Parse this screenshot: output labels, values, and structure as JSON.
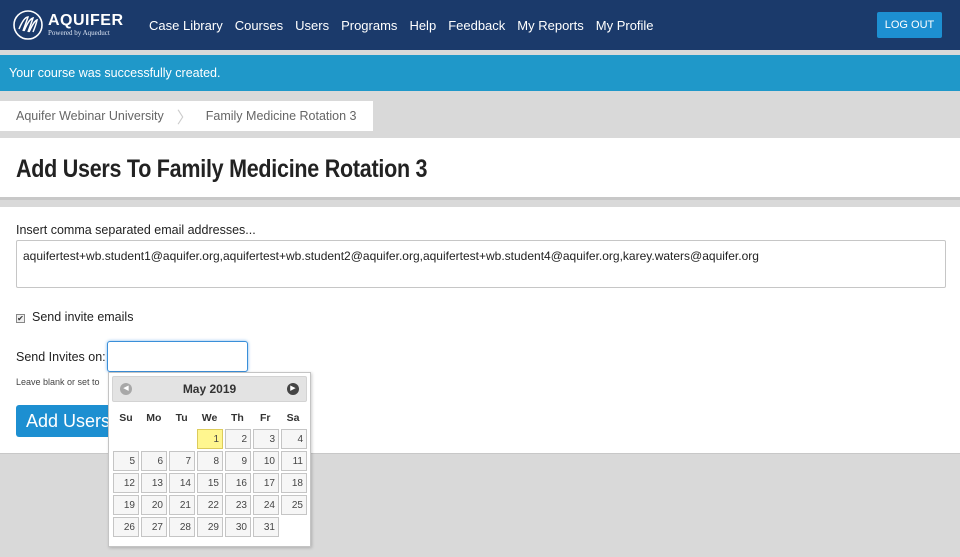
{
  "nav": {
    "logo_name": "AQUIFER",
    "logo_tagline": "Powered by Aqueduct",
    "links": [
      "Case Library",
      "Courses",
      "Users",
      "Programs",
      "Help",
      "Feedback",
      "My Reports",
      "My Profile"
    ],
    "logout_label": "LOG OUT"
  },
  "alert": {
    "message": "Your course was successfully created."
  },
  "breadcrumb": [
    "Aquifer Webinar University",
    "Family Medicine Rotation 3"
  ],
  "page": {
    "title": "Add Users To Family Medicine Rotation 3"
  },
  "form": {
    "emails_label": "Insert comma separated email addresses...",
    "emails_value": "aquifertest+wb.student1@aquifer.org,aquifertest+wb.student2@aquifer.org,aquifertest+wb.student4@aquifer.org,karey.waters@aquifer.org",
    "send_invites_label": "Send invite emails",
    "send_invites_checked": true,
    "send_on_label": "Send Invites on:",
    "send_on_value": "",
    "hint": "Leave blank or set to",
    "submit_label": "Add Users"
  },
  "datepicker": {
    "month_label": "May 2019",
    "weekdays": [
      "Su",
      "Mo",
      "Tu",
      "We",
      "Th",
      "Fr",
      "Sa"
    ],
    "first_weekday_index": 3,
    "days_in_month": 31,
    "today": 1
  },
  "colors": {
    "nav_bg": "#1b3a6b",
    "accent": "#1d8fd1",
    "alert_bg": "#1f98c9",
    "today_highlight": "#fff68f"
  }
}
